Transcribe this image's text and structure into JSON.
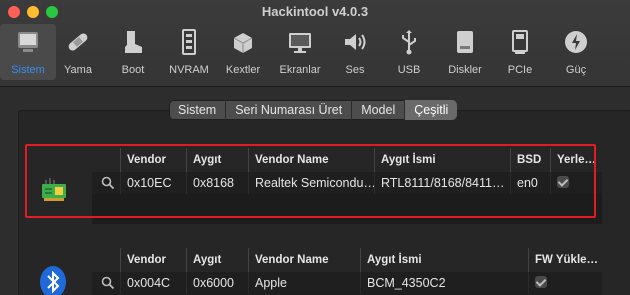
{
  "window": {
    "title": "Hackintool v4.0.3"
  },
  "toolbar": {
    "items": [
      {
        "label": "Sistem",
        "icon": "computer-icon",
        "active": true
      },
      {
        "label": "Yama",
        "icon": "bandage-icon"
      },
      {
        "label": "Boot",
        "icon": "boot-icon"
      },
      {
        "label": "NVRAM",
        "icon": "nvram-icon"
      },
      {
        "label": "Kextler",
        "icon": "lego-icon"
      },
      {
        "label": "Ekranlar",
        "icon": "display-icon"
      },
      {
        "label": "Ses",
        "icon": "speaker-icon"
      },
      {
        "label": "USB",
        "icon": "usb-icon"
      },
      {
        "label": "Diskler",
        "icon": "disk-icon"
      },
      {
        "label": "PCIe",
        "icon": "pcie-card-icon"
      },
      {
        "label": "Güç",
        "icon": "power-icon"
      }
    ]
  },
  "tabs": {
    "items": [
      "Sistem",
      "Seri Numarası Üret",
      "Model",
      "Çeşitli"
    ],
    "selected": "Çeşitli"
  },
  "network_table": {
    "headers": [
      "Vendor",
      "Aygıt",
      "Vendor Name",
      "Aygıt İsmi",
      "BSD",
      "Yerle…"
    ],
    "rows": [
      {
        "vendor": "0x10EC",
        "device": "0x8168",
        "vendor_name": "Realtek Semicondu…",
        "device_name": "RTL8111/8168/8411…",
        "bsd": "en0",
        "builtin": true
      }
    ]
  },
  "bluetooth_table": {
    "headers": [
      "Vendor",
      "Aygıt",
      "Vendor Name",
      "Aygıt İsmi",
      "FW Yükle…"
    ],
    "rows": [
      {
        "vendor": "0x004C",
        "device": "0x6000",
        "vendor_name": "Apple",
        "device_name": "BCM_4350C2",
        "fw_loaded": true
      }
    ]
  },
  "colors": {
    "accent": "#3b8cf0",
    "highlight_box": "#e31c23"
  }
}
